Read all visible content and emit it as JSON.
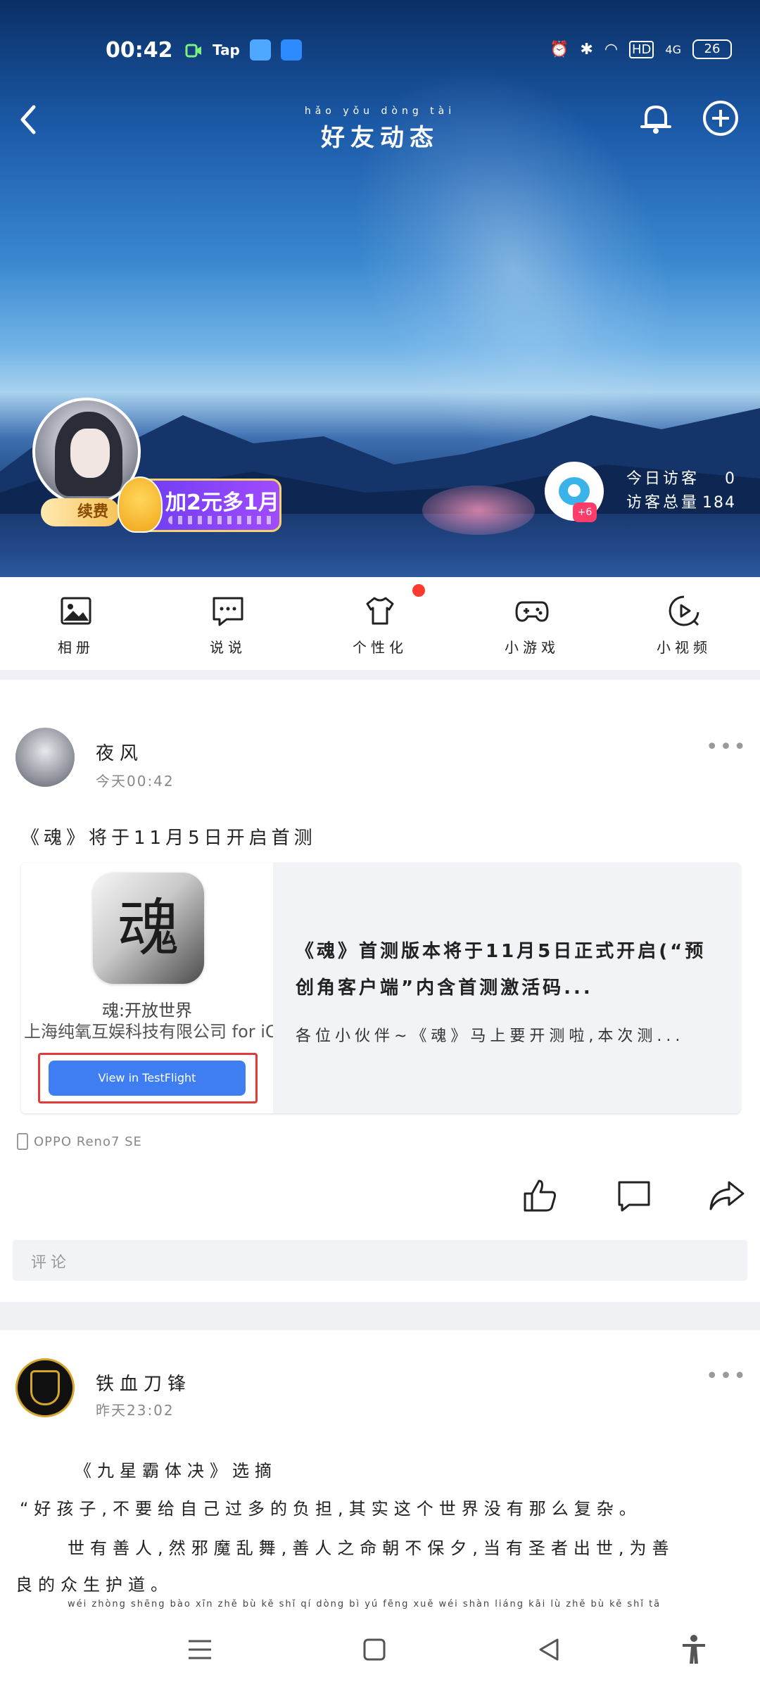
{
  "status": {
    "time": "00:42",
    "tap_label": "Tap",
    "hd_label": "HD",
    "net_label": "4G",
    "battery": "26"
  },
  "header": {
    "title": "好友动态",
    "title_pinyin": "hǎo yǒu dòng tài"
  },
  "profile": {
    "renew_label": "续费",
    "promo_label": "加2元多1月",
    "eye_badge": "+6",
    "today_visitors_label": "今日访客",
    "today_visitors_value": "0",
    "total_visits_label": "访客总量",
    "total_visits_value": "184"
  },
  "quick_actions": [
    {
      "label": "相册",
      "icon": "photo-album-icon"
    },
    {
      "label": "说说",
      "icon": "chat-bubble-icon"
    },
    {
      "label": "个性化",
      "icon": "tshirt-icon"
    },
    {
      "label": "小游戏",
      "icon": "gamepad-icon"
    },
    {
      "label": "小视频",
      "icon": "video-play-icon"
    }
  ],
  "post1": {
    "author": "夜风",
    "time": "今天00:42",
    "text": "《魂》将于11月5日开启首测",
    "card": {
      "app_glyph": "魂",
      "app_name": "魂:开放世界",
      "company": "上海纯氧互娱科技有限公司 for iOS",
      "button": "View in TestFlight",
      "title": "《魂》首测版本将于11月5日正式开启(“预创角客户端”内含首测激活码...",
      "desc": "各位小伙伴~《魂》马上要开测啦,本次测..."
    },
    "device": "OPPO Reno7 SE",
    "comment_placeholder": "评论"
  },
  "post2": {
    "author": "铁血刀锋",
    "time": "昨天23:02",
    "line1": "《九星霸体决》选摘",
    "line2": "“好孩子,不要给自己过多的负担,其实这个世界没有那么复杂。",
    "line3": "世有善人,然邪魔乱舞,善人之命朝不保夕,当有圣者出世,为善",
    "line4": "良的众生护道。",
    "line5": "wéi zhòng shēng bào xīn zhě   bù kě shǐ qí dòng bì yú fēng xuě   wéi shàn liáng kāi lù zhě   bù kě shǐ tā"
  },
  "colors": {
    "accent_red": "#ff3b2f",
    "testflight_blue": "#3f7df2",
    "promo_purple": "#8a45f8"
  }
}
